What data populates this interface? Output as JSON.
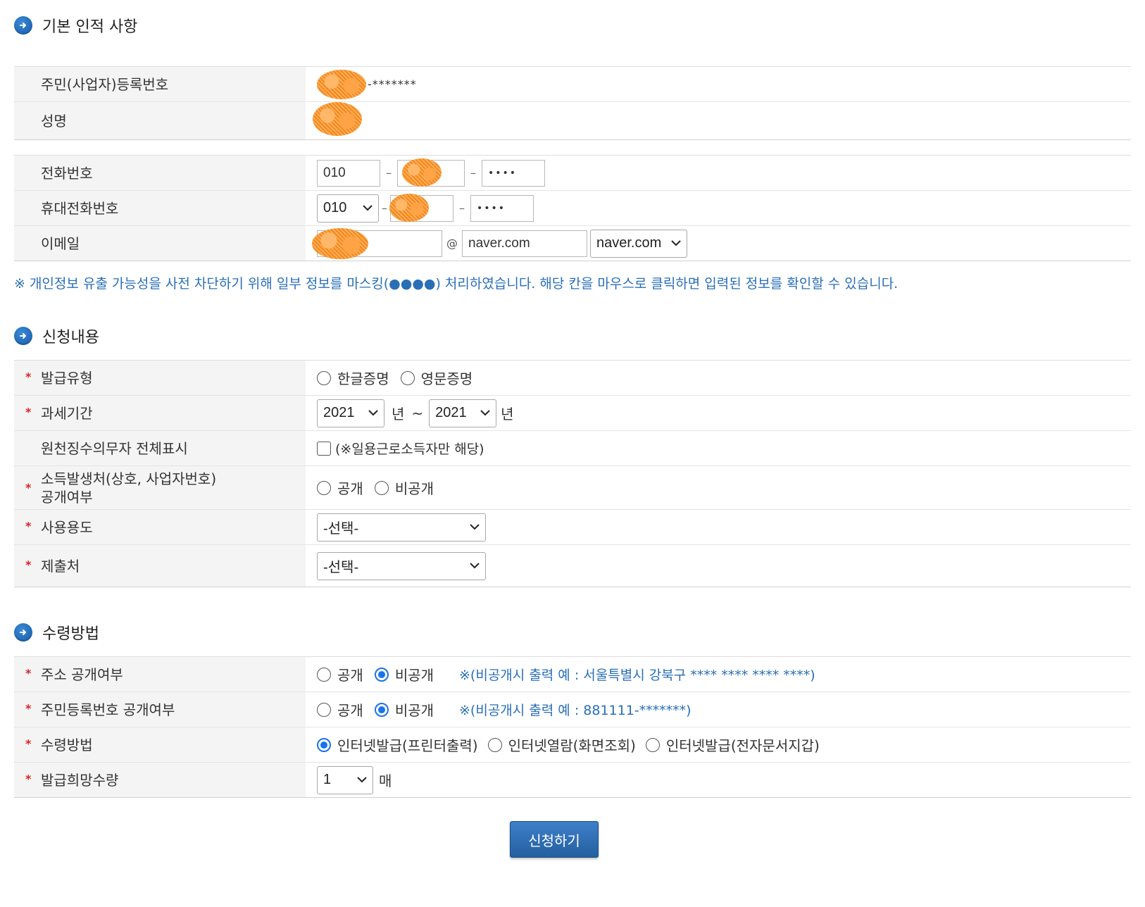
{
  "sections": {
    "basic_info": "기본 인적 사항",
    "application": "신청내용",
    "receipt": "수령방법"
  },
  "basic": {
    "rrn_label": "주민(사업자)등록번호",
    "rrn_masked_suffix": "-*******",
    "name_label": "성명",
    "phone_label": "전화번호",
    "phone_prefix": "010",
    "phone_last": "••••",
    "mobile_label": "휴대전화번호",
    "mobile_prefix": "010",
    "mobile_last": "••••",
    "email_label": "이메일",
    "email_at": "@",
    "email_domain": "naver.com",
    "email_domain_select": "naver.com"
  },
  "notice": "※ 개인정보 유출 가능성을 사전 차단하기 위해 일부 정보를 마스킹(●●●●) 처리하였습니다. 해당 칸을 마우스로 클릭하면 입력된 정보를 확인할 수 있습니다.",
  "required_mark": "*",
  "application": {
    "issue_type_label": "발급유형",
    "issue_type_options": [
      "한글증명",
      "영문증명"
    ],
    "tax_period_label": "과세기간",
    "tax_from": "2021",
    "tax_to": "2021",
    "year_unit": "년",
    "tilde": "~",
    "withholding_label": "원천징수의무자 전체표시",
    "withholding_note": "(※일용근로소득자만 해당)",
    "income_source_label_1": "소득발생처(상호, 사업자번호)",
    "income_source_label_2": "공개여부",
    "public": "공개",
    "private": "비공개",
    "usage_label": "사용용도",
    "usage_value": "-선택-",
    "submit_to_label": "제출처",
    "submit_to_value": "-선택-"
  },
  "receipt": {
    "address_label": "주소 공개여부",
    "address_note": "※(비공개시 출력 예 : 서울특별시 강북구 **** **** **** ****)",
    "rrn_label": "주민등록번호 공개여부",
    "rrn_note": "※(비공개시 출력 예 : 881111-*******)",
    "method_label": "수령방법",
    "method_options": [
      "인터넷발급(프린터출력)",
      "인터넷열람(화면조회)",
      "인터넷발급(전자문서지갑)"
    ],
    "quantity_label": "발급희망수량",
    "quantity_value": "1",
    "quantity_unit": "매"
  },
  "submit_label": "신청하기",
  "colors": {
    "accent_blue": "#2a6fb6",
    "required_red": "#dd2222",
    "header_bg": "#f4f4f4",
    "button_blue": "#2d6fb5"
  }
}
